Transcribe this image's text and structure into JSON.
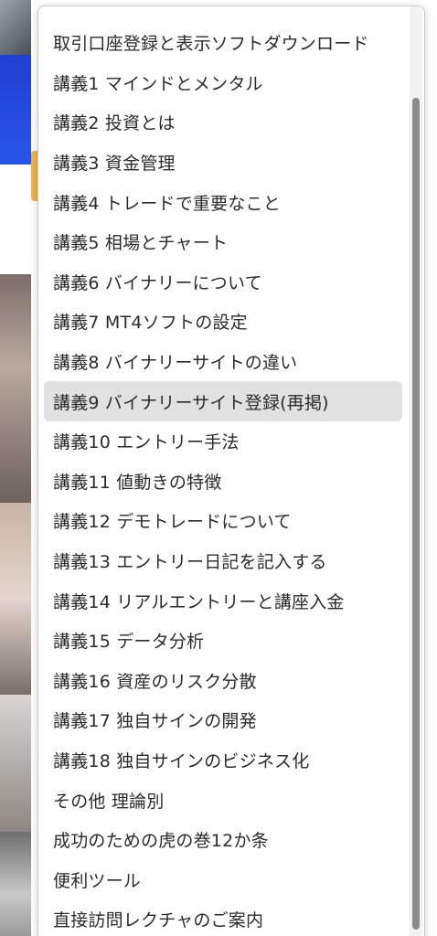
{
  "dropdown": {
    "items": [
      {
        "label": "取引口座登録と表示ソフトダウンロード"
      },
      {
        "label": "講義1 マインドとメンタル"
      },
      {
        "label": "講義2 投資とは"
      },
      {
        "label": "講義3 資金管理"
      },
      {
        "label": "講義4 トレードで重要なこと"
      },
      {
        "label": "講義5 相場とチャート"
      },
      {
        "label": "講義6 バイナリーについて"
      },
      {
        "label": "講義7 MT4ソフトの設定"
      },
      {
        "label": "講義8 バイナリーサイトの違い"
      },
      {
        "label": "講義9 バイナリーサイト登録(再掲)"
      },
      {
        "label": "講義10 エントリー手法"
      },
      {
        "label": "講義11 値動きの特徴"
      },
      {
        "label": "講義12 デモトレードについて"
      },
      {
        "label": "講義13 エントリー日記を記入する"
      },
      {
        "label": "講義14 リアルエントリーと講座入金"
      },
      {
        "label": "講義15 データ分析"
      },
      {
        "label": "講義16 資産のリスク分散"
      },
      {
        "label": "講義17 独自サインの開発"
      },
      {
        "label": "講義18 独自サインのビジネス化"
      },
      {
        "label": "その他 理論別"
      },
      {
        "label": "成功のための虎の巻12か条"
      },
      {
        "label": "便利ツール"
      },
      {
        "label": "直接訪問レクチャのご案内"
      }
    ],
    "selected_index": 9
  },
  "colors": {
    "selected_background": "#e1e1e1",
    "text": "#2b2b2b",
    "scroll_thumb": "#8c8c8c"
  }
}
